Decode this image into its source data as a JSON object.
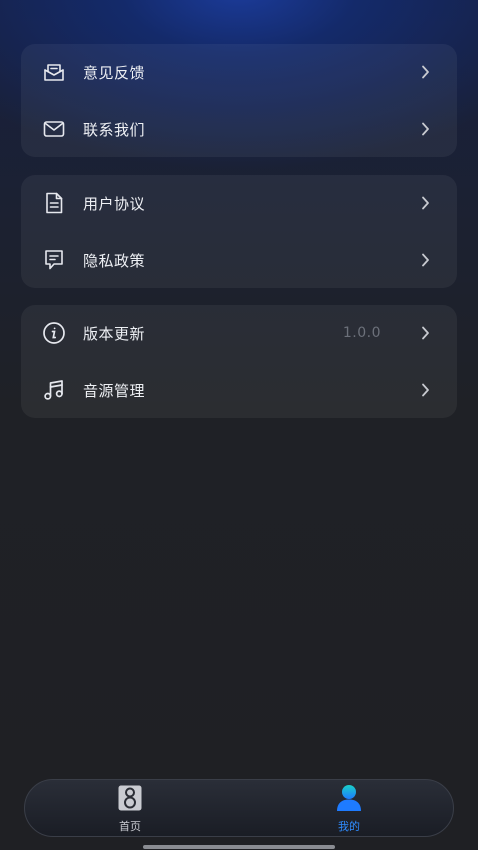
{
  "group1": {
    "feedback_label": "意见反馈",
    "contact_label": "联系我们"
  },
  "group2": {
    "agreement_label": "用户协议",
    "privacy_label": "隐私政策"
  },
  "group3": {
    "version_label": "版本更新",
    "version_value": "1.0.0",
    "audio_source_label": "音源管理"
  },
  "tabbar": {
    "home_label": "首页",
    "mine_label": "我的"
  },
  "icons": {
    "feedback": "mail-open-icon",
    "contact": "envelope-icon",
    "agreement": "document-icon",
    "privacy": "message-square-icon",
    "version": "info-circle-icon",
    "audio_source": "music-note-icon",
    "chevron": "chevron-right-icon",
    "home": "speaker-icon",
    "mine": "user-icon"
  },
  "colors": {
    "accent": "#2f8cff",
    "mine_icon_top": "#19d0c8",
    "mine_icon_bottom": "#1e7bff"
  }
}
